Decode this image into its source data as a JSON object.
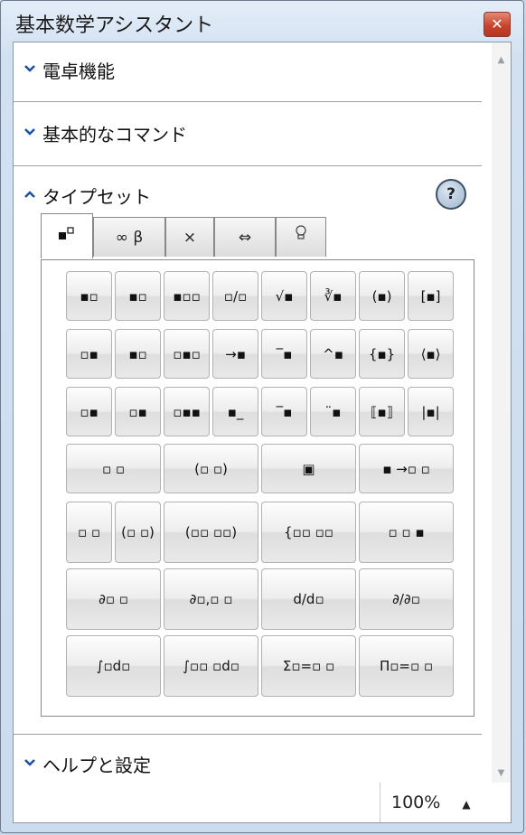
{
  "window": {
    "title": "基本数学アシスタント",
    "close_glyph": "✕"
  },
  "sections": {
    "calculator": {
      "label": "電卓機能",
      "chevron": "⌄"
    },
    "basic_commands": {
      "label": "基本的なコマンド",
      "chevron": "⌄"
    },
    "typeset": {
      "label": "タイプセット",
      "chevron": "⌃",
      "help": "?"
    },
    "help_settings": {
      "label": "ヘルプと設定",
      "chevron": "⌄"
    }
  },
  "tabs": [
    {
      "label": "▪▫",
      "icon": "superscript-icon",
      "active": true
    },
    {
      "label": "∞ β",
      "icon": "symbols-icon"
    },
    {
      "label": "×",
      "icon": "operator-icon"
    },
    {
      "label": "⇔",
      "icon": "arrows-icon"
    },
    {
      "label": "♀",
      "icon": "lightbulb-icon"
    }
  ],
  "palette": {
    "row1": [
      "▪▫",
      "▪▫",
      "▪▫▫",
      "▫/▫",
      "√▪",
      "∛▪",
      "(▪)",
      "[▪]"
    ],
    "row2": [
      "▫▪",
      "▪▫",
      "▫▪▫",
      "→▪",
      "‾▪",
      "^▪",
      "{▪}",
      "⟨▪⟩"
    ],
    "row3": [
      "▫▪",
      "▫▪",
      "▫▪▪",
      "▪_",
      "‾▪",
      "¨▪",
      "⟦▪⟧",
      "|▪|"
    ],
    "row4": [
      "▫  ▫",
      "(▫  ▫)",
      "▣",
      "▪ →▫ ▫"
    ],
    "row5": [
      "▫ ▫",
      "(▫ ▫)",
      "(▫▫ ▫▫)",
      "{▫▫ ▫▫",
      "▫ ▫ ▪"
    ],
    "row6": [
      "∂▫ ▫",
      "∂▫,▫ ▫",
      "d/d▫",
      "∂/∂▫"
    ],
    "row7": [
      "∫▫d▫",
      "∫▫▫ ▫d▫",
      "Σ▫=▫ ▫",
      "Π▫=▫ ▫"
    ]
  },
  "zoom": {
    "value": "100%",
    "arrow": "▲"
  },
  "scroll": {
    "up": "▲",
    "down": "▼"
  }
}
